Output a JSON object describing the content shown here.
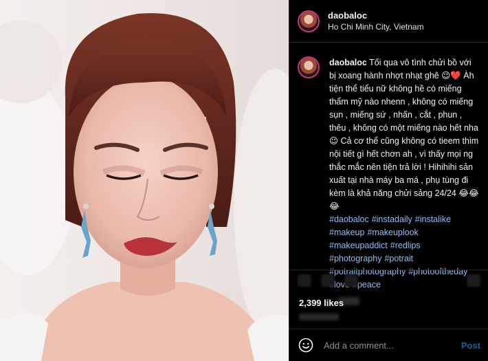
{
  "post": {
    "username": "daobaloc",
    "location": "Ho Chi Minh City, Vietnam",
    "caption": "Tối qua vô tình chửi bồ với bị xoang hành nhợt nhạt ghê 😉❤️ Àh tiện thể tiểu nữ không hề có miếng thẩm mỹ nào nhenn , không có miếng sụn , miếng sứ , nhấn , cắt , phun , thêu , không có một miếng nào hết nha 😉 Cả cơ thể cũng không có tieem thim nội tiết gì hết chơn ah , vì thấy mọi ng thắc mắc nên tiện trả lời ! Hihihihi sản xuất tại nhà máy ba má , phụ tùng đi kèm là khả năng chửi sảng 24/24 😂😂😂",
    "hashtags": [
      "#daobaloc",
      "#instadaily",
      "#instalike",
      "#makeup",
      "#makeuplook",
      "#makeupaddict",
      "#redlips",
      "#photography",
      "#potrait",
      "#potraitphotography",
      "#photooftheday",
      "#love",
      "#peace"
    ],
    "likes": "2,399 likes"
  },
  "comment_box": {
    "placeholder": "Add a comment...",
    "post_label": "Post"
  },
  "icons": {
    "emoji": "smiley-face-icon",
    "like": "heart-icon",
    "comment": "comment-bubble-icon",
    "share": "paper-plane-icon",
    "save": "bookmark-icon"
  },
  "colors": {
    "background": "#000000",
    "hashtag": "#8fbef5",
    "muted": "#8e8e8e",
    "post_button": "#1e5f8c"
  }
}
